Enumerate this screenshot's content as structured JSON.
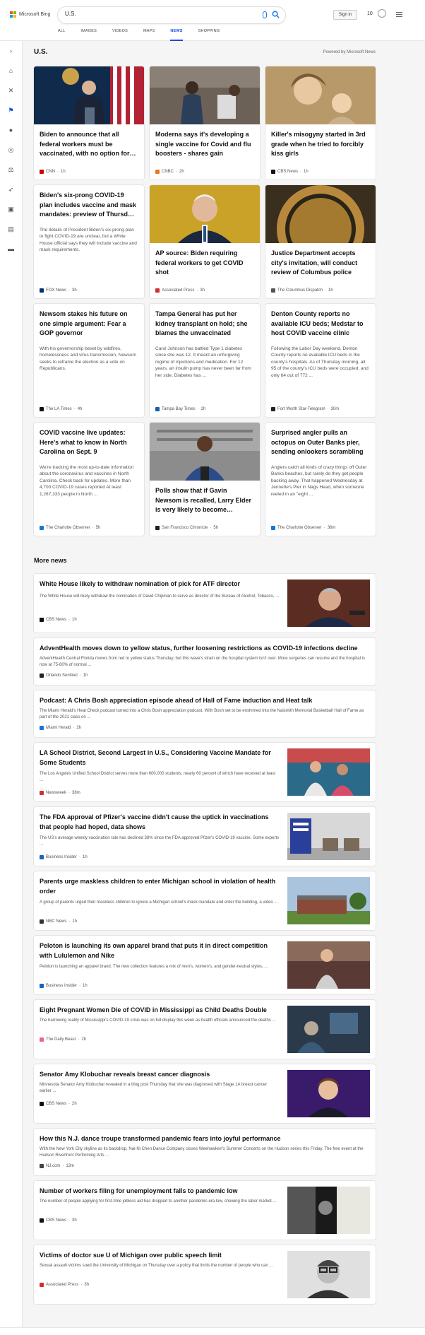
{
  "brand": {
    "name": "Microsoft Bing"
  },
  "search": {
    "value": "U.S."
  },
  "header": {
    "signin_label": "Sign in",
    "rewards_count": "10"
  },
  "tabs": [
    {
      "label": "ALL"
    },
    {
      "label": "IMAGES"
    },
    {
      "label": "VIDEOS"
    },
    {
      "label": "MAPS"
    },
    {
      "label": "NEWS"
    },
    {
      "label": "SHOPPING"
    }
  ],
  "main": {
    "title": "U.S.",
    "powered_by": "Powered by Microsoft News"
  },
  "cards": [
    {
      "title": "Biden to announce that all federal workers must be vaccinated, with no option for…",
      "snippet": "",
      "source": "CNN",
      "age": "1h",
      "src_color": "#cc0000"
    },
    {
      "title": "Moderna says it's developing a single vaccine for Covid and flu boosters - shares gain",
      "snippet": "",
      "source": "CNBC",
      "age": "2h",
      "src_color": "#e87722"
    },
    {
      "title": "Killer's misogyny started in 3rd grade when he tried to forcibly kiss girls",
      "snippet": "",
      "source": "CBS News",
      "age": "1h",
      "src_color": "#111111"
    },
    {
      "title": "Biden's six-prong COVID-19 plan includes vaccine and mask mandates: preview of Thursd…",
      "snippet": "The details of President Biden's six-prong plan to fight COVID-19 are unclear, but a White House official says they will include vaccine and mask requirements.",
      "source": "FOX News",
      "age": "3h",
      "src_color": "#003366"
    },
    {
      "title": "AP source: Biden requiring federal workers to get COVID shot",
      "snippet": "",
      "source": "Associated Press",
      "age": "3h",
      "src_color": "#d32f2f"
    },
    {
      "title": "Justice Department accepts city's invitation, will conduct review of Columbus police",
      "snippet": "",
      "source": "The Columbus Dispatch",
      "age": "1h",
      "src_color": "#555555"
    },
    {
      "title": "Newsom stakes his future on one simple argument: Fear a GOP governor",
      "snippet": "With his governorship beset by wildfires, homelessness and virus transmission, Newsom seeks to reframe the election as a vote on Republicans.",
      "source": "The LA Times",
      "age": "4h",
      "src_color": "#111111"
    },
    {
      "title": "Tampa General has put her kidney transplant on hold; she blames the unvaccinated",
      "snippet": "Carol Johnson has battled Type 1 diabetes since she was 12. It meant an unforgiving regime of injections and medication. For 12 years, an insulin pump has never been far from her side. Diabetes has ...",
      "source": "Tampa Bay Times",
      "age": "2h",
      "src_color": "#1a5fa8"
    },
    {
      "title": "Denton County reports no available ICU beds; Medstar to host COVID vaccine clinic",
      "snippet": "Following the Labor Day weekend, Denton County reports no available ICU beds in the county's hospitals. As of Thursday morning, all 95 of the county's ICU beds were occupied, and only 64 out of 772 ...",
      "source": "Fort Worth Star-Telegram",
      "age": "30m",
      "src_color": "#222222"
    },
    {
      "title": "COVID vaccine live updates: Here's what to know in North Carolina on Sept. 9",
      "snippet": "We're tracking the most up-to-date information about the coronavirus and vaccines in North Carolina. Check back for updates. More than 4,700 COVID-19 cases reported At least 1,267,333 people in North ...",
      "source": "The Charlotte Observer",
      "age": "5h",
      "src_color": "#1976d2"
    },
    {
      "title": "Polls show that if Gavin Newsom is recalled, Larry Elder is very likely to become…",
      "snippet": "",
      "source": "San Francisco Chronicle",
      "age": "5h",
      "src_color": "#222222"
    },
    {
      "title": "Surprised angler pulls an octopus on Outer Banks pier, sending onlookers scrambling",
      "snippet": "Anglers catch all kinds of crazy things off Outer Banks beaches, but rarely do they get people backing away. That happened Wednesday at Jennette's Pier in Nags Head, when someone reeled in an \"eight ...",
      "source": "The Charlotte Observer",
      "age": "36m",
      "src_color": "#1976d2"
    }
  ],
  "more_news": {
    "title": "More news"
  },
  "items": [
    {
      "title": "White House likely to withdraw nomination of pick for ATF director",
      "snippet": "The White House will likely withdraw the nomination of David Chipman to serve as director of the Bureau of Alcohol, Tobacco, ...",
      "source": "CBS News",
      "age": "1h",
      "src_color": "#111111"
    },
    {
      "title": "AdventHealth moves down to yellow status, further loosening restrictions as COVID-19 infections decline",
      "snippet": "AdventHealth Central Florida moves from red to yellow status Thursday, but this wave's strain on the hospital system isn't over. More surgeries can resume and the hospital is now at 75-80% of normal ...",
      "source": "Orlando Sentinel",
      "age": "1h",
      "src_color": "#222222"
    },
    {
      "title": "Podcast: A Chris Bosh appreciation episode ahead of Hall of Fame induction and Heat talk",
      "snippet": "The Miami Herald's Heat Check podcast turned into a Chris Bosh appreciation podcast. With Bosh set to be enshrined into the Naismith Memorial Basketball Hall of Fame as part of the 2021 class on ...",
      "source": "Miami Herald",
      "age": "2h",
      "src_color": "#1976d2"
    },
    {
      "title": "LA School District, Second Largest in U.S., Considering Vaccine Mandate for Some Students",
      "snippet": "The Los Angeles Unified School District serves more than 600,000 students, nearly 60 percent of which have received at least ...",
      "source": "Newsweek",
      "age": "38m",
      "src_color": "#d32f2f"
    },
    {
      "title": "The FDA approval of Pfizer's vaccine didn't cause the uptick in vaccinations that people had hoped, data shows",
      "snippet": "The US's average weekly vaccination rate has declined 38% since the FDA approved Pfizer's COVID-19 vaccine. Some experts ...",
      "source": "Business Insider",
      "age": "1h",
      "src_color": "#1565c0"
    },
    {
      "title": "Parents urge maskless children to enter Michigan school in violation of health order",
      "snippet": "A group of parents urged their maskless children to ignore a Michigan school's mask mandate and enter the building, a video ...",
      "source": "NBC News",
      "age": "1h",
      "src_color": "#333333"
    },
    {
      "title": "Peloton is launching its own apparel brand that puts it in direct competition with Lululemon and Nike",
      "snippet": "Peloton is launching an apparel brand. The new collection features a mix of men's, women's, and gender-neutral styles, ...",
      "source": "Business Insider",
      "age": "1h",
      "src_color": "#1565c0"
    },
    {
      "title": "Eight Pregnant Women Die of COVID in Mississippi as Child Deaths Double",
      "snippet": "The harrowing reality of Mississippi's COVID-19 crisis was on full display this week as health officials announced the deaths ...",
      "source": "The Daily Beast",
      "age": "2h",
      "src_color": "#f06292"
    },
    {
      "title": "Senator Amy Klobuchar reveals breast cancer diagnosis",
      "snippet": "Minnesota Senator Amy Klobuchar revealed in a blog post Thursday that she was diagnosed with Stage 1A breast cancer earlier ...",
      "source": "CBS News",
      "age": "2h",
      "src_color": "#111111"
    },
    {
      "title": "How this N.J. dance troupe transformed pandemic fears into joyful performance",
      "snippet": "With the New York City skyline as its backdrop, Nai-Ni Chen Dance Company closes Weehawken's Summer Concerts on the Hudson series this Friday. The free event at the Hudson Riverfront Performing Arts ...",
      "source": "NJ.com",
      "age": "13m",
      "src_color": "#444444"
    },
    {
      "title": "Number of workers filing for unemployment falls to pandemic low",
      "snippet": "The number of people applying for first-time jobless aid has dropped to another pandemic-era low, showing the labor market ...",
      "source": "CBS News",
      "age": "3h",
      "src_color": "#111111"
    },
    {
      "title": "Victims of doctor sue U of Michigan over public speech limit",
      "snippet": "Sexual assault victims sued the University of Michigan on Thursday over a policy that limits the number of people who can ...",
      "source": "Associated Press",
      "age": "3h",
      "src_color": "#d32f2f"
    }
  ],
  "colors": {
    "accent": "#174ae4",
    "background": "#f5f5f5"
  }
}
